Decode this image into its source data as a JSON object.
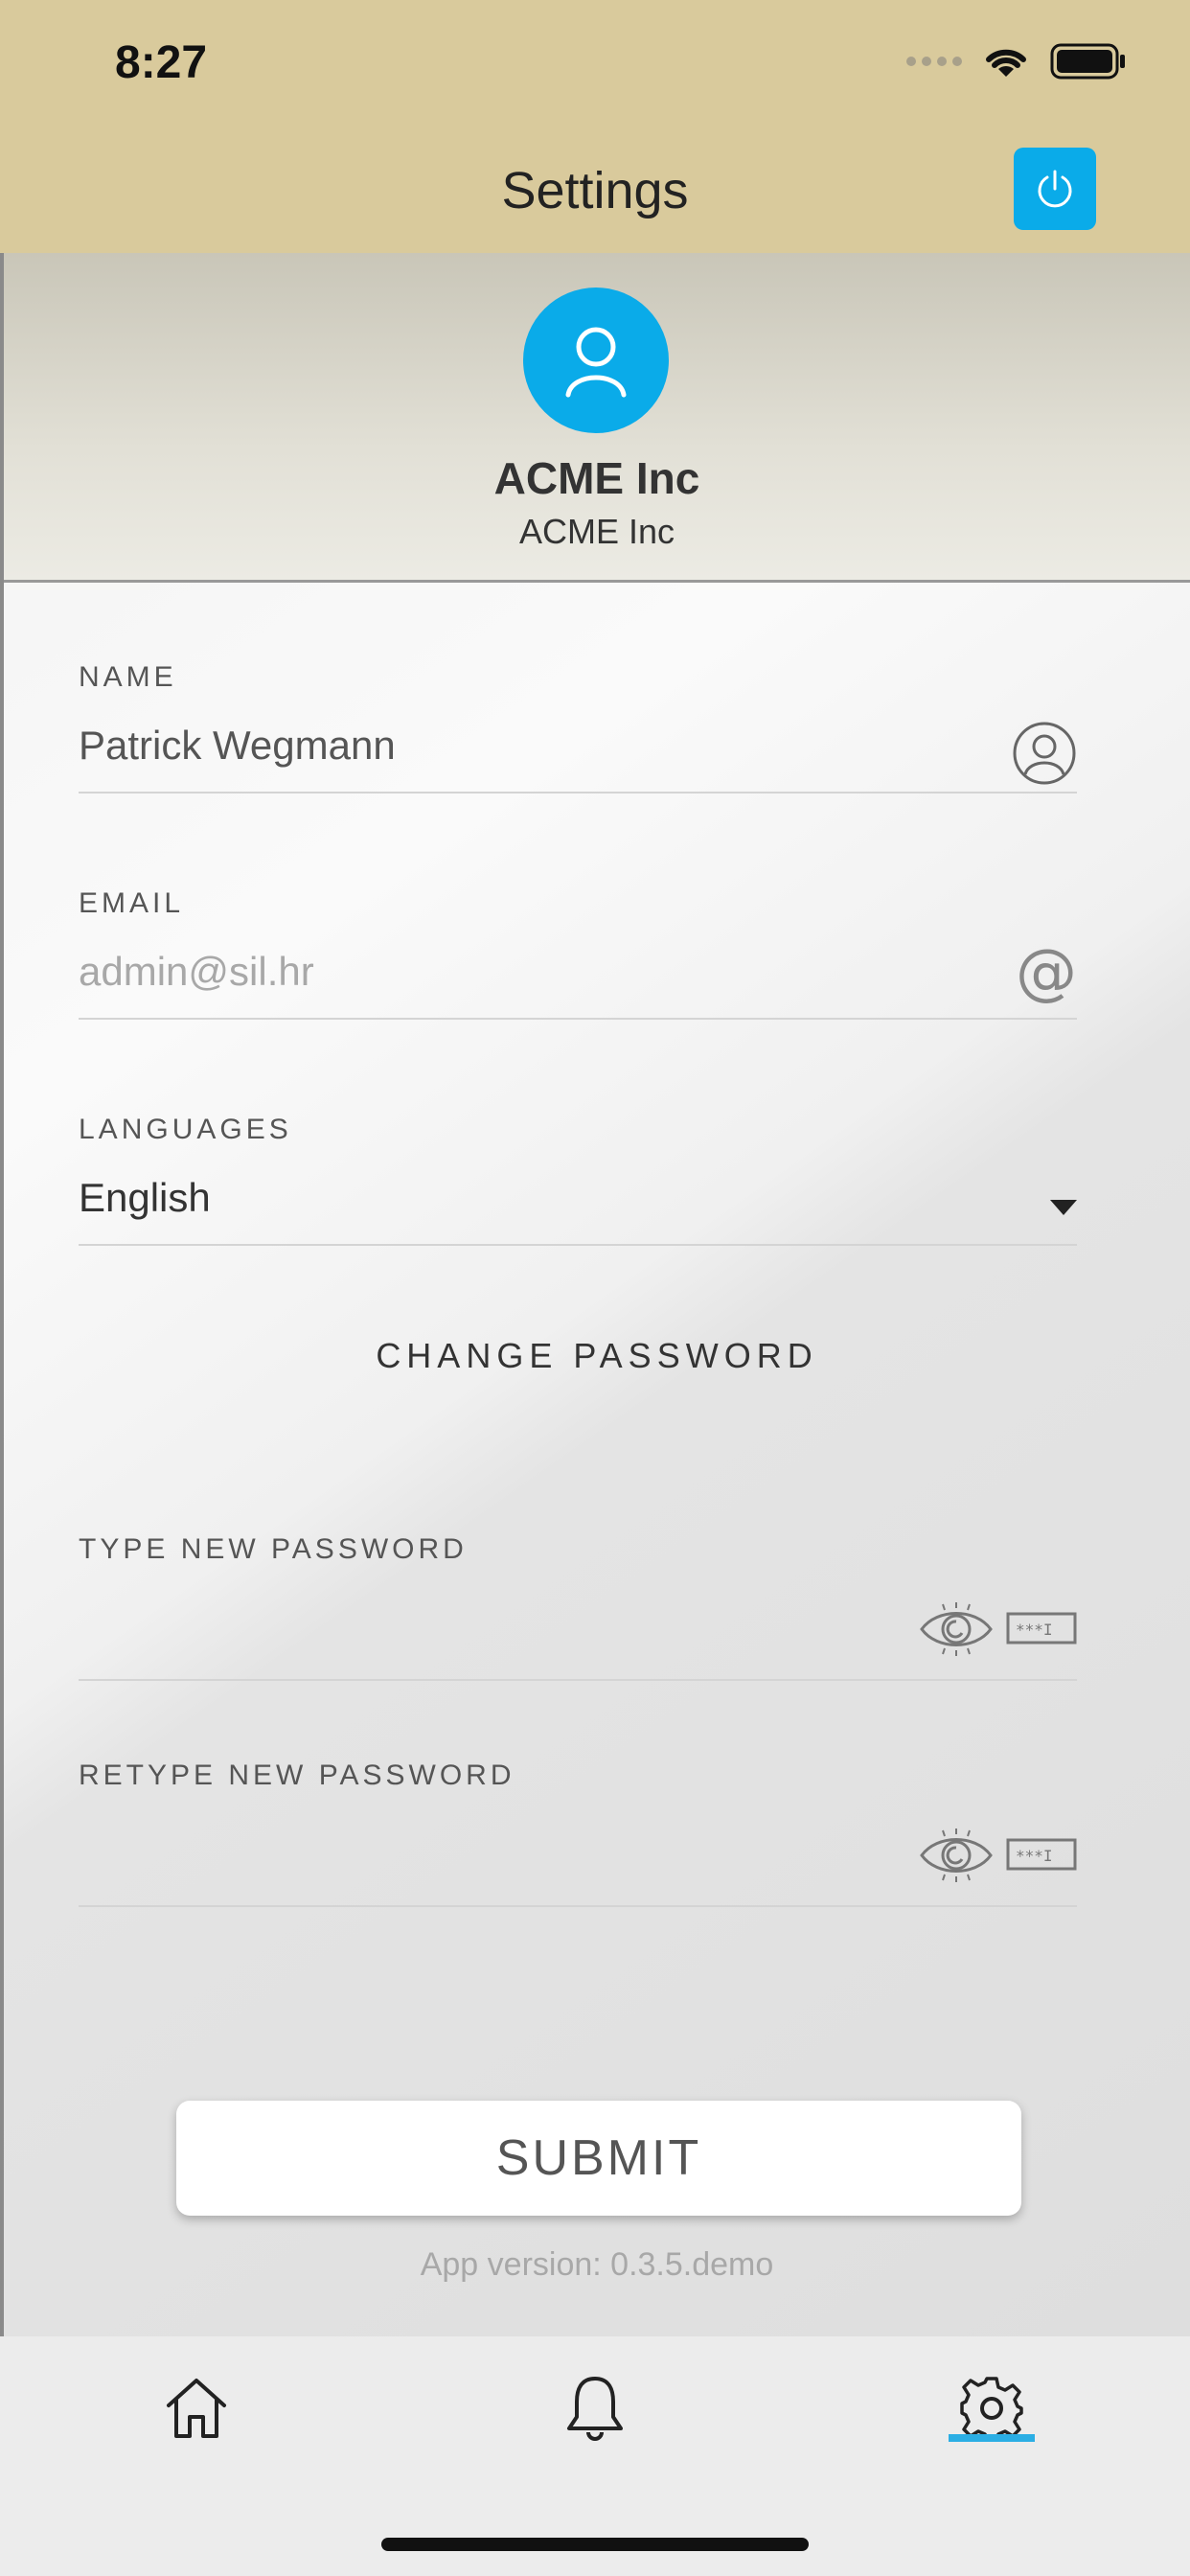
{
  "status_bar": {
    "time": "8:27"
  },
  "nav": {
    "title": "Settings",
    "power_icon": "power-icon"
  },
  "profile": {
    "company_name": "ACME Inc",
    "company_subtitle": "ACME Inc",
    "avatar_icon": "user-icon",
    "accent": "#0aabe9"
  },
  "form": {
    "name": {
      "label": "NAME",
      "value": "Patrick Wegmann",
      "icon": "user-circle-icon"
    },
    "email": {
      "label": "EMAIL",
      "placeholder": "admin@sil.hr",
      "icon": "at-icon"
    },
    "languages": {
      "label": "LANGUAGES",
      "value": "English",
      "icon": "caret-down-icon"
    },
    "change_password": "CHANGE PASSWORD",
    "new_password": {
      "label": "TYPE NEW PASSWORD",
      "icons": [
        "eye-icon",
        "password-mask-icon"
      ]
    },
    "retype_password": {
      "label": "RETYPE NEW PASSWORD",
      "icons": [
        "eye-icon",
        "password-mask-icon"
      ]
    },
    "submit_label": "SUBMIT",
    "app_version": "App version: 0.3.5.demo"
  },
  "tab_bar": {
    "tabs": [
      {
        "name": "home",
        "icon": "home-icon"
      },
      {
        "name": "notifications",
        "icon": "bell-icon"
      },
      {
        "name": "settings",
        "icon": "gear-icon",
        "active": true
      }
    ],
    "active_color": "#2baee4"
  }
}
